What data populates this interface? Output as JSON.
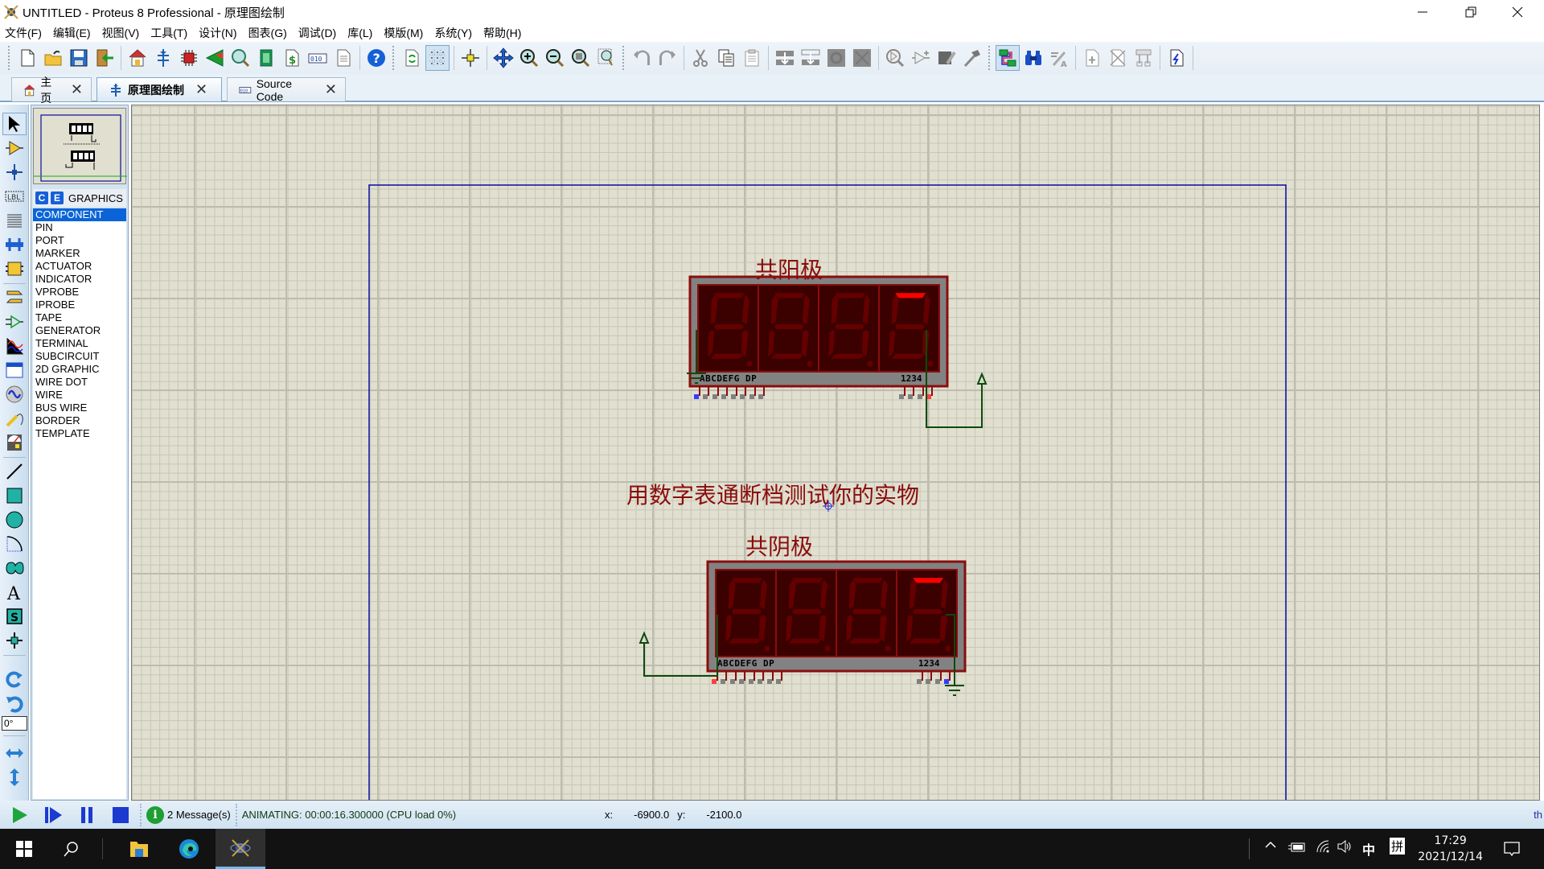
{
  "window": {
    "title": "UNTITLED - Proteus 8 Professional - 原理图绘制",
    "minimize_label": "minimize",
    "restore_label": "restore",
    "close_label": "close"
  },
  "menubar": {
    "items": [
      {
        "label": "文件(F)"
      },
      {
        "label": "编辑(E)"
      },
      {
        "label": "视图(V)"
      },
      {
        "label": "工具(T)"
      },
      {
        "label": "设计(N)"
      },
      {
        "label": "图表(G)"
      },
      {
        "label": "调试(D)"
      },
      {
        "label": "库(L)"
      },
      {
        "label": "模版(M)"
      },
      {
        "label": "系统(Y)"
      },
      {
        "label": "帮助(H)"
      }
    ]
  },
  "toolbar": {
    "buttons": [
      {
        "icon": "new-file-icon"
      },
      {
        "icon": "open-folder-icon"
      },
      {
        "icon": "save-icon"
      },
      {
        "icon": "import-icon"
      },
      {
        "icon": "home-icon"
      },
      {
        "icon": "schematic-icon"
      },
      {
        "icon": "pcb-icon"
      },
      {
        "icon": "3d-viewer-icon"
      },
      {
        "icon": "gerber-viewer-icon"
      },
      {
        "icon": "design-explorer-icon"
      },
      {
        "icon": "bill-of-materials-icon"
      },
      {
        "icon": "source-code-icon"
      },
      {
        "icon": "notes-icon"
      },
      {
        "icon": "help-icon"
      },
      {
        "icon": "redraw-icon"
      },
      {
        "icon": "grid-toggle-icon"
      },
      {
        "icon": "origin-icon"
      },
      {
        "icon": "pan-icon"
      },
      {
        "icon": "zoom-in-icon"
      },
      {
        "icon": "zoom-out-icon"
      },
      {
        "icon": "zoom-all-icon"
      },
      {
        "icon": "zoom-area-icon"
      },
      {
        "icon": "undo-icon"
      },
      {
        "icon": "redo-icon"
      },
      {
        "icon": "cut-icon"
      },
      {
        "icon": "copy-icon"
      },
      {
        "icon": "paste-icon"
      },
      {
        "icon": "block-copy-icon"
      },
      {
        "icon": "block-move-icon"
      },
      {
        "icon": "block-rotate-icon"
      },
      {
        "icon": "block-delete-icon"
      },
      {
        "icon": "pick-device-icon"
      },
      {
        "icon": "make-device-icon"
      },
      {
        "icon": "packaging-tool-icon"
      },
      {
        "icon": "decompose-icon"
      },
      {
        "icon": "wire-autorouter-icon"
      },
      {
        "icon": "search-tag-icon"
      },
      {
        "icon": "property-assignment-icon"
      },
      {
        "icon": "new-sheet-icon"
      },
      {
        "icon": "remove-sheet-icon"
      },
      {
        "icon": "exit-to-parent-icon"
      },
      {
        "icon": "netlist-to-ares-icon"
      }
    ]
  },
  "tabs": [
    {
      "label": "主页",
      "icon": "home-icon",
      "close": "✕"
    },
    {
      "label": "原理图绘制",
      "icon": "schematic-icon",
      "close": "✕",
      "active": true
    },
    {
      "label": "Source Code",
      "icon": "source-code-icon",
      "close": "✕"
    }
  ],
  "tools": [
    {
      "name": "selection-mode"
    },
    {
      "name": "component-mode"
    },
    {
      "name": "junction-dot-mode"
    },
    {
      "name": "wire-label-mode"
    },
    {
      "name": "text-script-mode"
    },
    {
      "name": "buses-mode"
    },
    {
      "name": "subcircuit-mode"
    },
    {
      "name": "terminals-mode"
    },
    {
      "name": "device-pins-mode"
    },
    {
      "name": "graph-mode"
    },
    {
      "name": "active-popup-mode"
    },
    {
      "name": "generator-mode"
    },
    {
      "name": "probe-mode"
    },
    {
      "name": "virtual-instruments-mode"
    },
    {
      "name": "2d-line-mode"
    },
    {
      "name": "2d-box-mode"
    },
    {
      "name": "2d-circle-mode"
    },
    {
      "name": "2d-arc-mode"
    },
    {
      "name": "2d-path-mode"
    },
    {
      "name": "2d-text-mode"
    },
    {
      "name": "2d-symbol-mode"
    },
    {
      "name": "2d-marker-mode"
    },
    {
      "name": "rotate-clockwise"
    },
    {
      "name": "rotate-anticlockwise"
    },
    {
      "name": "mirror-x"
    },
    {
      "name": "mirror-y"
    }
  ],
  "rotation": {
    "value": "0°"
  },
  "selector": {
    "badge_c": "C",
    "badge_e": "E",
    "title": "GRAPHICS",
    "items": [
      "COMPONENT",
      "PIN",
      "PORT",
      "MARKER",
      "ACTUATOR",
      "INDICATOR",
      "VPROBE",
      "IPROBE",
      "TAPE",
      "GENERATOR",
      "TERMINAL",
      "SUBCIRCUIT",
      "2D GRAPHIC",
      "WIRE DOT",
      "WIRE",
      "BUS WIRE",
      "BORDER",
      "TEMPLATE"
    ],
    "selected": "COMPONENT"
  },
  "canvas": {
    "label_anode": "共阳极",
    "label_cathode": "共阴极",
    "label_instruction": "用数字表通断档测试你的实物",
    "display_top": {
      "pin_label_left": "ABCDEFG DP",
      "pin_label_right": "1234",
      "lit_segments": [
        {
          "digit": 4,
          "segment": "A"
        }
      ]
    },
    "display_bottom": {
      "pin_label_left": "ABCDEFG DP",
      "pin_label_right": "1234",
      "lit_segments": [
        {
          "digit": 4,
          "segment": "A"
        }
      ]
    },
    "colors": {
      "component_border": "#8b0d0d",
      "display_bg": "#3b0000",
      "segment_off": "#650000",
      "segment_on": "#ff0000",
      "wire": "#0d4a0d",
      "sheet_border": "#0a0aa0",
      "pin_high": "#ff4040",
      "pin_low": "#3a3aff",
      "pin_floating": "#808080"
    }
  },
  "statusbar": {
    "messages": "2 Message(s)",
    "status": "ANIMATING: 00:00:16.300000 (CPU load 0%)",
    "x_label": "x:",
    "x_value": "-6900.0",
    "y_label": "y:",
    "y_value": "-2100.0",
    "th": "th"
  },
  "taskbar": {
    "time": "17:29",
    "date": "2021/12/14",
    "ime_lang": "中",
    "ime_mode": "拼"
  }
}
